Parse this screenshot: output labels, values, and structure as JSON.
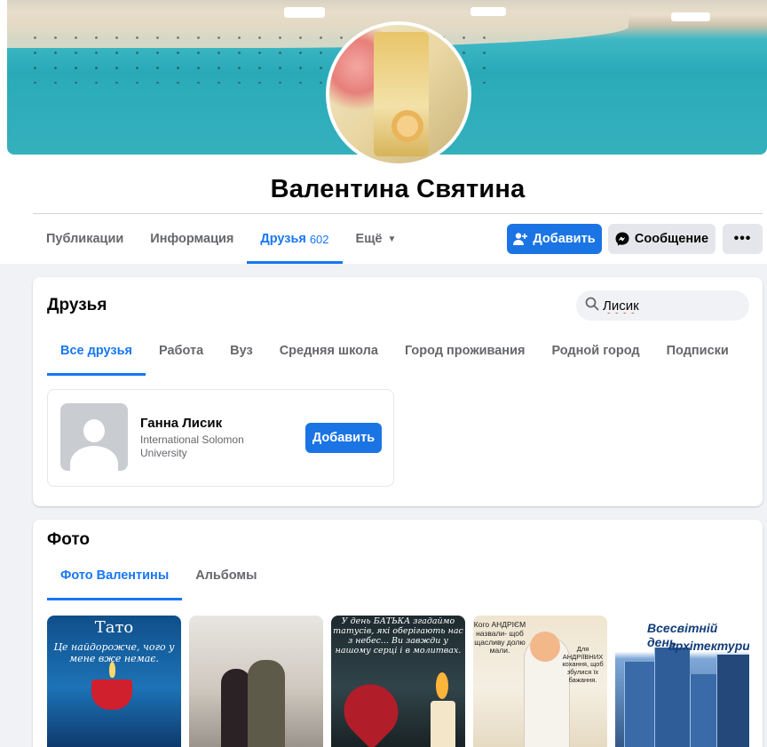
{
  "profile": {
    "name": "Валентина Святина"
  },
  "nav": {
    "tabs": [
      {
        "label": "Публикации"
      },
      {
        "label": "Информация"
      },
      {
        "label": "Друзья",
        "count": "602"
      },
      {
        "label": "Ещё"
      }
    ]
  },
  "actions": {
    "add_label": "Добавить",
    "message_label": "Сообщение",
    "more_label": "•••"
  },
  "friends": {
    "title": "Друзья",
    "search_value": "Лисик",
    "tabs": [
      "Все друзья",
      "Работа",
      "Вуз",
      "Средняя школа",
      "Город проживания",
      "Родной город",
      "Подписки"
    ],
    "results": [
      {
        "name": "Ганна Лисик",
        "subtitle": "International Solomon University",
        "button": "Добавить"
      }
    ]
  },
  "photos": {
    "title": "Фото",
    "tabs": [
      "Фото Валентины",
      "Альбомы"
    ],
    "thumbs": [
      {
        "caption": "Тато",
        "caption2": "Це найдорожче, чого у мене вже немає."
      },
      {
        "caption": ""
      },
      {
        "caption": "У день БАТЬКА згадаймо татусів, які оберігають нас з небес... Ви завжди у нашому серці і в молитвах."
      },
      {
        "caption": "Кого АНДРІЄМ назвали- щоб щасливу долю мали.",
        "caption2": "Для АНДРІЇВНИХ кохання, щоб збулися їх бажання."
      },
      {
        "caption": "Всесвітній день",
        "caption2": "архітектури"
      }
    ]
  },
  "colors": {
    "accent": "#1877f2",
    "button_blue": "#1b74e4",
    "button_grey": "#e4e6eb",
    "page_bg": "#f0f2f5"
  },
  "icons": {
    "add_friend": "person-plus-icon",
    "message": "messenger-icon",
    "search": "search-icon",
    "caret": "caret-down-icon"
  }
}
